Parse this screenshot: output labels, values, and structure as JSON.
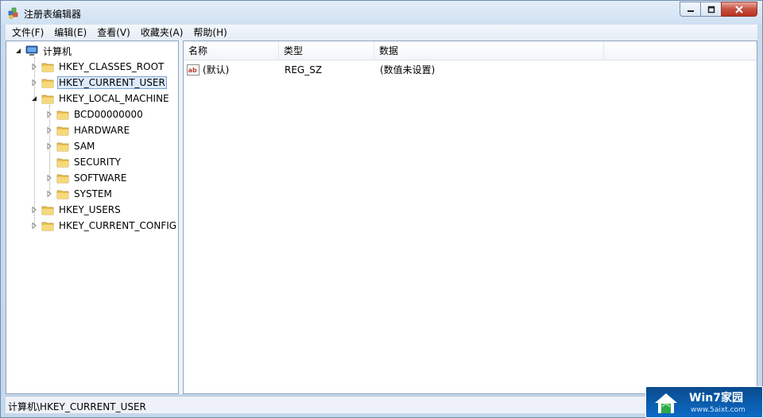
{
  "window": {
    "title": "注册表编辑器",
    "icon": "regedit-icon"
  },
  "menu": [
    {
      "label": "文件(F)"
    },
    {
      "label": "编辑(E)"
    },
    {
      "label": "查看(V)"
    },
    {
      "label": "收藏夹(A)"
    },
    {
      "label": "帮助(H)"
    }
  ],
  "tree": {
    "root": "计算机",
    "nodes": [
      {
        "label": "HKEY_CLASSES_ROOT",
        "expanded": false
      },
      {
        "label": "HKEY_CURRENT_USER",
        "expanded": false,
        "selected": true
      },
      {
        "label": "HKEY_LOCAL_MACHINE",
        "expanded": true
      },
      {
        "label": "BCD00000000",
        "expanded": false
      },
      {
        "label": "HARDWARE",
        "expanded": false
      },
      {
        "label": "SAM",
        "expanded": false
      },
      {
        "label": "SECURITY",
        "expanded": false
      },
      {
        "label": "SOFTWARE",
        "expanded": false
      },
      {
        "label": "SYSTEM",
        "expanded": false
      },
      {
        "label": "HKEY_USERS",
        "expanded": false
      },
      {
        "label": "HKEY_CURRENT_CONFIG",
        "expanded": false
      }
    ]
  },
  "list": {
    "columns": [
      "名称",
      "类型",
      "数据"
    ],
    "rows": [
      {
        "name": "(默认)",
        "type": "REG_SZ",
        "data": "(数值未设置)",
        "icon": "reg-sz-icon"
      }
    ]
  },
  "status": {
    "path": "计算机\\HKEY_CURRENT_USER"
  },
  "watermark": {
    "title": "Win7家园",
    "url": "www.5aixt.com"
  },
  "colors": {
    "selection": "#dceafc",
    "folder": "#e8c35a",
    "close_button": "#c7503f"
  }
}
